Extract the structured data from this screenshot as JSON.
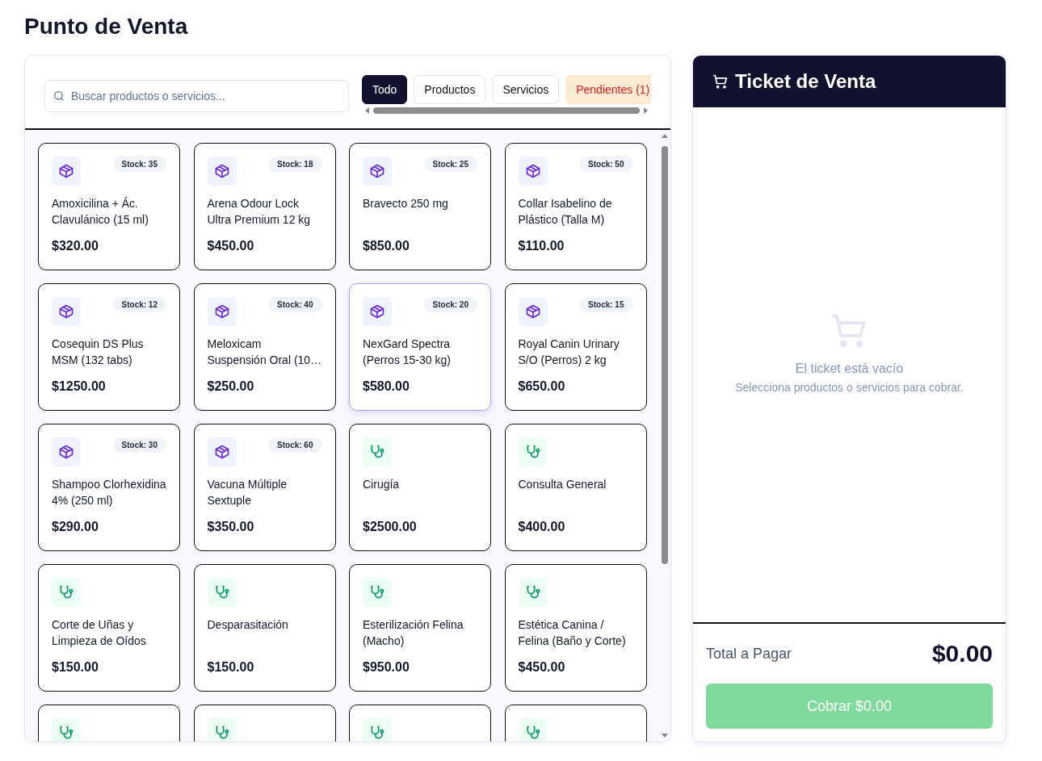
{
  "page_title": "Punto de Venta",
  "search": {
    "placeholder": "Buscar productos o servicios..."
  },
  "tabs": [
    {
      "label": "Todo",
      "selected": true,
      "kind": "normal"
    },
    {
      "label": "Productos",
      "selected": false,
      "kind": "normal"
    },
    {
      "label": "Servicios",
      "selected": false,
      "kind": "normal"
    },
    {
      "label": "Pendientes (1)",
      "selected": false,
      "kind": "pending"
    }
  ],
  "items": [
    {
      "kind": "product",
      "name": "Amoxicilina + Ác. Clavulánico (15 ml)",
      "stock": "Stock: 35",
      "price": "$320.00",
      "hovered": false
    },
    {
      "kind": "product",
      "name": "Arena Odour Lock Ultra Premium 12 kg",
      "stock": "Stock: 18",
      "price": "$450.00",
      "hovered": false
    },
    {
      "kind": "product",
      "name": "Bravecto 250 mg",
      "stock": "Stock: 25",
      "price": "$850.00",
      "hovered": false
    },
    {
      "kind": "product",
      "name": "Collar Isabelino de Plástico (Talla M)",
      "stock": "Stock: 50",
      "price": "$110.00",
      "hovered": false
    },
    {
      "kind": "product",
      "name": "Cosequin DS Plus MSM (132 tabs)",
      "stock": "Stock: 12",
      "price": "$1250.00",
      "hovered": false
    },
    {
      "kind": "product",
      "name": "Meloxicam Suspensión Oral (10…",
      "stock": "Stock: 40",
      "price": "$250.00",
      "hovered": false
    },
    {
      "kind": "product",
      "name": "NexGard Spectra (Perros 15-30 kg)",
      "stock": "Stock: 20",
      "price": "$580.00",
      "hovered": true
    },
    {
      "kind": "product",
      "name": "Royal Canin Urinary S/O (Perros) 2 kg",
      "stock": "Stock: 15",
      "price": "$650.00",
      "hovered": false
    },
    {
      "kind": "product",
      "name": "Shampoo Clorhexidina 4% (250 ml)",
      "stock": "Stock: 30",
      "price": "$290.00",
      "hovered": false
    },
    {
      "kind": "product",
      "name": "Vacuna Múltiple Sextuple",
      "stock": "Stock: 60",
      "price": "$350.00",
      "hovered": false
    },
    {
      "kind": "service",
      "name": "Cirugía",
      "price": "$2500.00",
      "hovered": false
    },
    {
      "kind": "service",
      "name": "Consulta General",
      "price": "$400.00",
      "hovered": false
    },
    {
      "kind": "service",
      "name": "Corte de Uñas y Limpieza de Oídos",
      "price": "$150.00",
      "hovered": false
    },
    {
      "kind": "service",
      "name": "Desparasitación",
      "price": "$150.00",
      "hovered": false
    },
    {
      "kind": "service",
      "name": "Esterilización Felina (Macho)",
      "price": "$950.00",
      "hovered": false
    },
    {
      "kind": "service",
      "name": "Estética Canina / Felina (Baño y Corte)",
      "price": "$450.00",
      "hovered": false
    },
    {
      "kind": "service",
      "hovered": false
    },
    {
      "kind": "service",
      "hovered": false
    },
    {
      "kind": "service",
      "hovered": false
    },
    {
      "kind": "service",
      "hovered": false
    }
  ],
  "ticket": {
    "title": "Ticket de Venta",
    "empty_title": "El ticket está vacío",
    "empty_hint": "Selecciona productos o servicios para cobrar.",
    "total_label": "Total a Pagar",
    "total": "$0.00",
    "charge_button": {
      "label": "Cobrar $0.00",
      "disabled": true
    }
  }
}
